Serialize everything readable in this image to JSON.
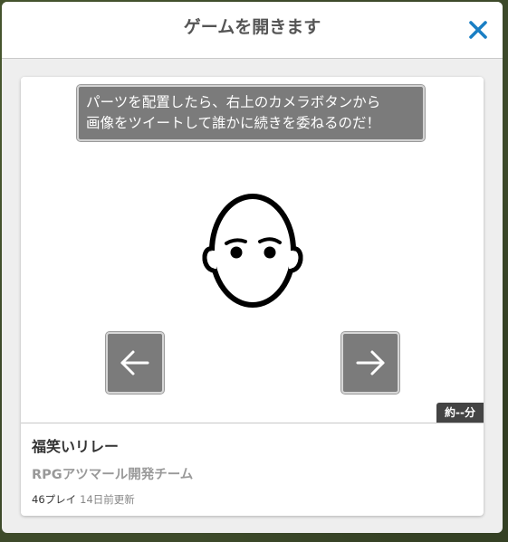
{
  "modal": {
    "title": "ゲームを開きます",
    "close_icon": "close-icon",
    "accent_color": "#1a7fc4"
  },
  "game": {
    "instruction_line1": "パーツを配置したら、右上のカメラボタンから",
    "instruction_line2": "画像をツイートして誰かに続きを委ねるのだ！",
    "prev_icon": "arrow-left-icon",
    "next_icon": "arrow-right-icon",
    "duration": "約--分"
  },
  "info": {
    "title": "福笑いリレー",
    "author": "RPGアツマール開発チーム",
    "plays": "46プレイ",
    "updated": "14日前更新"
  }
}
